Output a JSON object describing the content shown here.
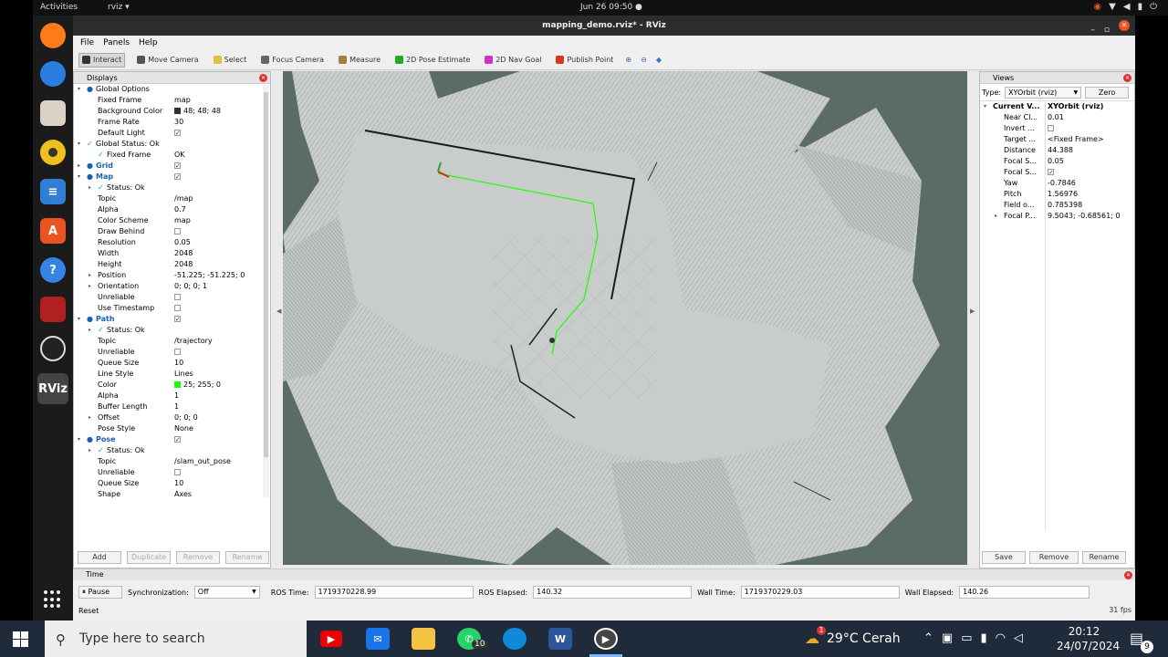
{
  "ubuntu_bar": {
    "activities": "Activities",
    "app_menu": "rviz ▾",
    "datetime": "Jun 26  09:50  ●"
  },
  "window": {
    "title": "mapping_demo.rviz* - RViz"
  },
  "menu": [
    "File",
    "Panels",
    "Help"
  ],
  "tools": [
    {
      "label": "Interact",
      "icon": "interact-icon",
      "color": "#333333"
    },
    {
      "label": "Move Camera",
      "icon": "move-camera-icon",
      "color": "#555555"
    },
    {
      "label": "Select",
      "icon": "select-icon",
      "color": "#e0c040"
    },
    {
      "label": "Focus Camera",
      "icon": "focus-camera-icon",
      "color": "#666666"
    },
    {
      "label": "Measure",
      "icon": "measure-icon",
      "color": "#a08040"
    },
    {
      "label": "2D Pose Estimate",
      "icon": "pose-estimate-icon",
      "color": "#22aa22"
    },
    {
      "label": "2D Nav Goal",
      "icon": "nav-goal-icon",
      "color": "#cc33cc"
    },
    {
      "label": "Publish Point",
      "icon": "publish-point-icon",
      "color": "#dd3322"
    }
  ],
  "displays_panel": {
    "title": "Displays",
    "rows": [
      {
        "key": "Global Options",
        "value": "",
        "indent": 0,
        "arrow": "▾",
        "kind": "blue-dot"
      },
      {
        "key": "Fixed Frame",
        "value": "map",
        "indent": 1
      },
      {
        "key": "Background Color",
        "value": "48; 48; 48",
        "indent": 1,
        "swatch": "#303030"
      },
      {
        "key": "Frame Rate",
        "value": "30",
        "indent": 1
      },
      {
        "key": "Default Light",
        "value": "",
        "indent": 1,
        "check": true
      },
      {
        "key": "Global Status: Ok",
        "value": "",
        "indent": 0,
        "arrow": "▾",
        "kind": "ok"
      },
      {
        "key": "Fixed Frame",
        "value": "OK",
        "indent": 1,
        "kind": "ok"
      },
      {
        "key": "Grid",
        "value": "",
        "indent": 0,
        "arrow": "▸",
        "check": true,
        "blue": true
      },
      {
        "key": "Map",
        "value": "",
        "indent": 0,
        "arrow": "▾",
        "check": true,
        "blue": true
      },
      {
        "key": "Status: Ok",
        "value": "",
        "indent": 1,
        "arrow": "▸",
        "kind": "ok"
      },
      {
        "key": "Topic",
        "value": "/map",
        "indent": 1
      },
      {
        "key": "Alpha",
        "value": "0.7",
        "indent": 1
      },
      {
        "key": "Color Scheme",
        "value": "map",
        "indent": 1
      },
      {
        "key": "Draw Behind",
        "value": "",
        "indent": 1,
        "check": false
      },
      {
        "key": "Resolution",
        "value": "0.05",
        "indent": 1
      },
      {
        "key": "Width",
        "value": "2048",
        "indent": 1
      },
      {
        "key": "Height",
        "value": "2048",
        "indent": 1
      },
      {
        "key": "Position",
        "value": "-51.225; -51.225; 0",
        "indent": 1,
        "arrow": "▸"
      },
      {
        "key": "Orientation",
        "value": "0; 0; 0; 1",
        "indent": 1,
        "arrow": "▸"
      },
      {
        "key": "Unreliable",
        "value": "",
        "indent": 1,
        "check": false
      },
      {
        "key": "Use Timestamp",
        "value": "",
        "indent": 1,
        "check": false
      },
      {
        "key": "Path",
        "value": "",
        "indent": 0,
        "arrow": "▾",
        "check": true,
        "blue": true
      },
      {
        "key": "Status: Ok",
        "value": "",
        "indent": 1,
        "arrow": "▸",
        "kind": "ok"
      },
      {
        "key": "Topic",
        "value": "/trajectory",
        "indent": 1
      },
      {
        "key": "Unreliable",
        "value": "",
        "indent": 1,
        "check": false
      },
      {
        "key": "Queue Size",
        "value": "10",
        "indent": 1
      },
      {
        "key": "Line Style",
        "value": "Lines",
        "indent": 1
      },
      {
        "key": "Color",
        "value": "25; 255; 0",
        "indent": 1,
        "swatch": "#19ff00"
      },
      {
        "key": "Alpha",
        "value": "1",
        "indent": 1
      },
      {
        "key": "Buffer Length",
        "value": "1",
        "indent": 1
      },
      {
        "key": "Offset",
        "value": "0; 0; 0",
        "indent": 1,
        "arrow": "▸"
      },
      {
        "key": "Pose Style",
        "value": "None",
        "indent": 1
      },
      {
        "key": "Pose",
        "value": "",
        "indent": 0,
        "arrow": "▾",
        "check": true,
        "blue": true
      },
      {
        "key": "Status: Ok",
        "value": "",
        "indent": 1,
        "arrow": "▸",
        "kind": "ok"
      },
      {
        "key": "Topic",
        "value": "/slam_out_pose",
        "indent": 1
      },
      {
        "key": "Unreliable",
        "value": "",
        "indent": 1,
        "check": false
      },
      {
        "key": "Queue Size",
        "value": "10",
        "indent": 1
      },
      {
        "key": "Shape",
        "value": "Axes",
        "indent": 1
      }
    ],
    "buttons": {
      "add": "Add",
      "duplicate": "Duplicate",
      "remove": "Remove",
      "rename": "Rename"
    }
  },
  "views_panel": {
    "title": "Views",
    "type_label": "Type:",
    "type_value": "XYOrbit (rviz)",
    "zero": "Zero",
    "rows": [
      {
        "key": "Current V...",
        "value": "XYOrbit (rviz)",
        "indent": 0,
        "arrow": "▾",
        "bold": true
      },
      {
        "key": "Near Cl...",
        "value": "0.01",
        "indent": 1
      },
      {
        "key": "Invert ...",
        "value": "",
        "indent": 1,
        "check": false
      },
      {
        "key": "Target ...",
        "value": "<Fixed Frame>",
        "indent": 1
      },
      {
        "key": "Distance",
        "value": "44.388",
        "indent": 1
      },
      {
        "key": "Focal S...",
        "value": "0.05",
        "indent": 1
      },
      {
        "key": "Focal S...",
        "value": "",
        "indent": 1,
        "check": true
      },
      {
        "key": "Yaw",
        "value": "-0.7846",
        "indent": 1
      },
      {
        "key": "Pitch",
        "value": "1.56976",
        "indent": 1
      },
      {
        "key": "Field o...",
        "value": "0.785398",
        "indent": 1
      },
      {
        "key": "Focal P...",
        "value": "9.5043; -0.68561; 0",
        "indent": 1,
        "arrow": "▸"
      }
    ],
    "buttons": {
      "save": "Save",
      "remove": "Remove",
      "rename": "Rename"
    }
  },
  "time_panel": {
    "title": "Time",
    "pause": "Pause",
    "sync_label": "Synchronization:",
    "sync_value": "Off",
    "ros_time_label": "ROS Time:",
    "ros_time": "1719370228.99",
    "ros_elapsed_label": "ROS Elapsed:",
    "ros_elapsed": "140.32",
    "wall_time_label": "Wall Time:",
    "wall_time": "1719370229.03",
    "wall_elapsed_label": "Wall Elapsed:",
    "wall_elapsed": "140.26",
    "reset": "Reset",
    "fps": "31 fps"
  },
  "taskbar": {
    "search_placeholder": "Type here to search",
    "whatsapp_badge": "10",
    "weather": "29°C  Cerah",
    "weather_badge": "1",
    "time": "20:12",
    "date": "24/07/2024",
    "notif_count": "9"
  },
  "colors": {
    "map_bg": "#5b6b66",
    "map_free": "#c4c9c7",
    "path": "#19ff00",
    "accent_orange": "#e95420"
  }
}
